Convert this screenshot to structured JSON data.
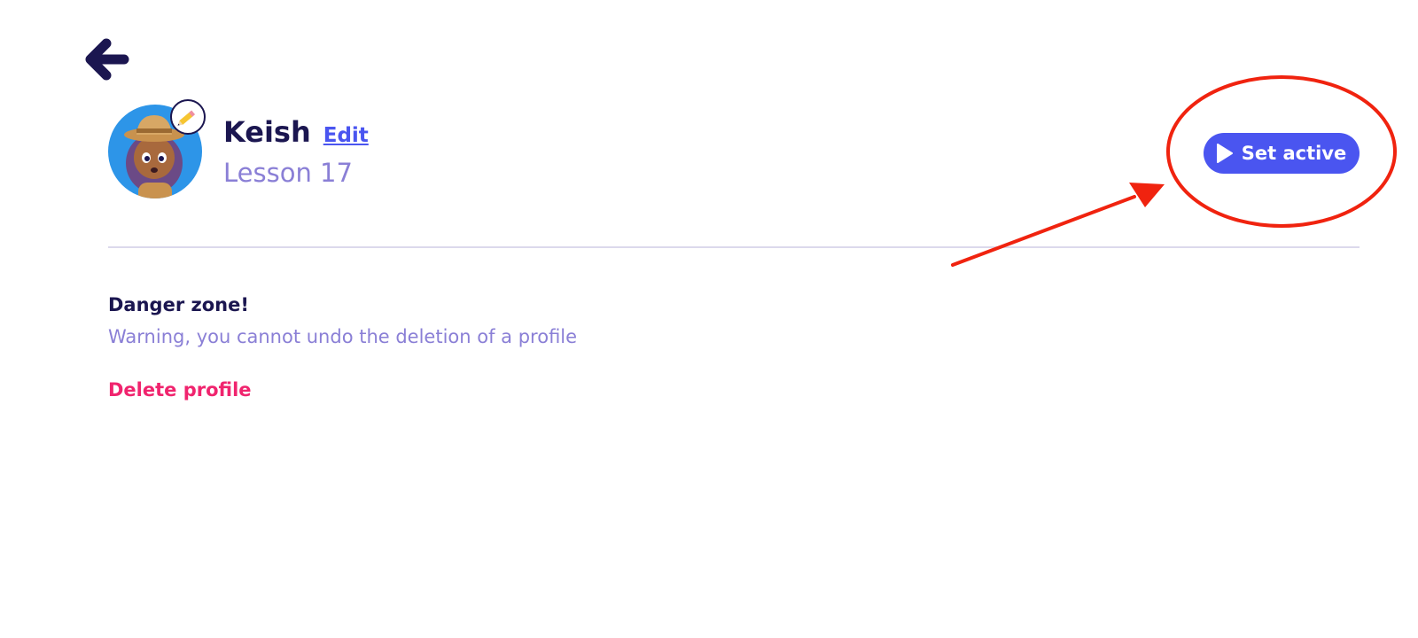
{
  "profile": {
    "name": "Keish",
    "edit_label": "Edit",
    "lesson": "Lesson 17",
    "avatar_icon": "explorer-girl-avatar",
    "avatar_bg": "#2d95e8"
  },
  "actions": {
    "set_active_label": "Set active",
    "set_active_icon": "play-icon"
  },
  "danger_zone": {
    "title": "Danger zone!",
    "warning": "Warning, you cannot undo the deletion of a profile",
    "delete_label": "Delete profile"
  },
  "colors": {
    "primary_text": "#1b1650",
    "accent": "#4a55f0",
    "muted": "#8a7fd6",
    "danger": "#f0246e",
    "annotation": "#f0230f"
  }
}
